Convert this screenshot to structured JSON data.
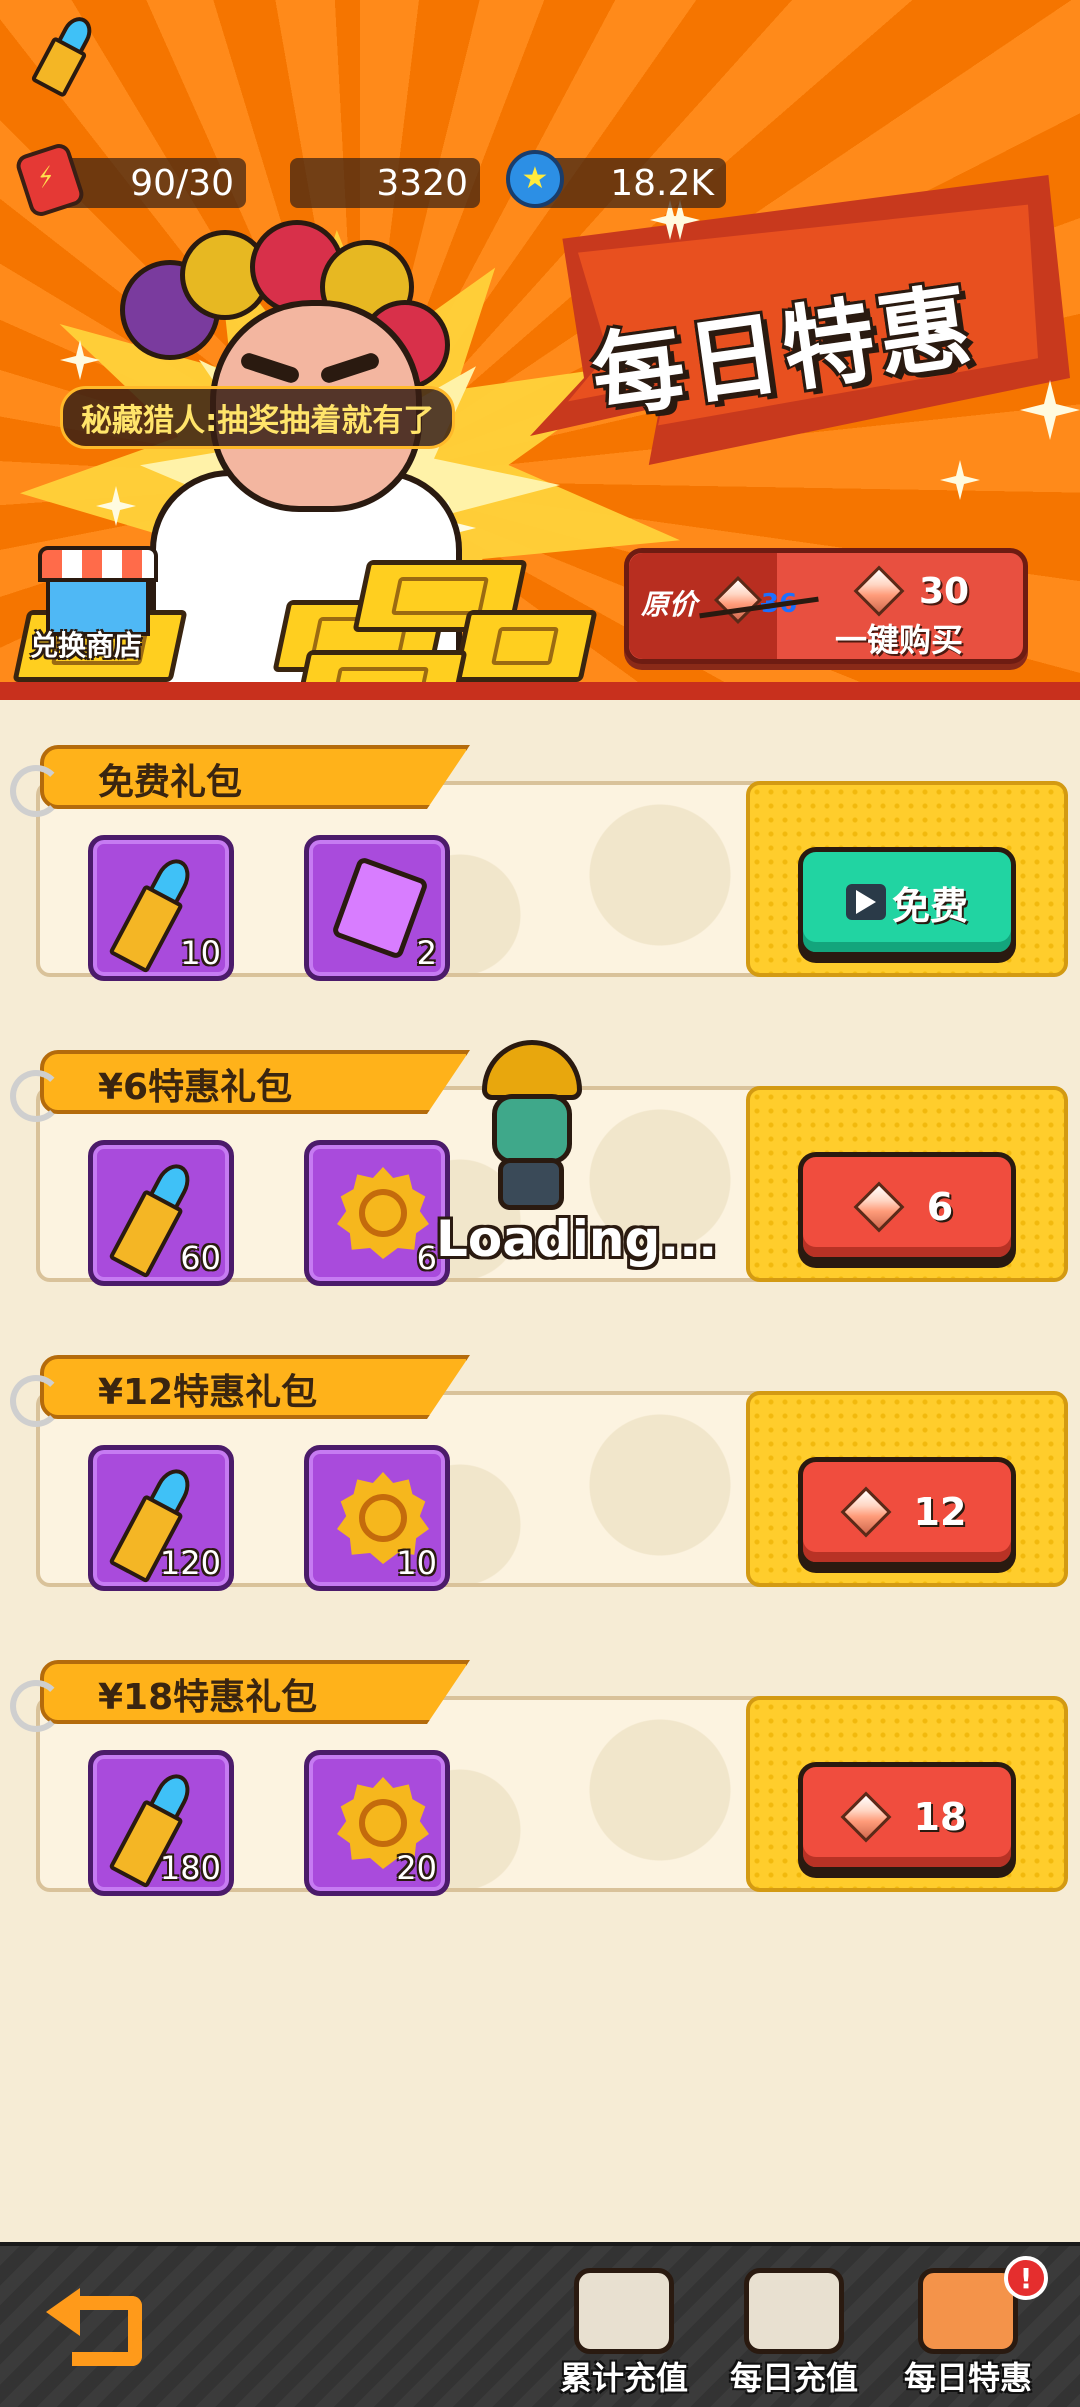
{
  "resources": [
    {
      "icon": "energy-can-icon",
      "value": "90/30"
    },
    {
      "icon": "bullet-icon",
      "value": "3320"
    },
    {
      "icon": "coin-icon",
      "value": "18.2K"
    }
  ],
  "hero": {
    "title": "每日特惠",
    "hunter_text": "秘藏猎人:抽奖抽着就有了",
    "shop_label": "兑换商店",
    "original_price_label": "原价",
    "original_price": "36",
    "buy_all_price": "30",
    "buy_all_label": "一键购买"
  },
  "packs": [
    {
      "name": "免费礼包",
      "items": [
        {
          "icon": "bullet-icon",
          "count": "10"
        },
        {
          "icon": "purple-cube-icon",
          "count": "2"
        }
      ],
      "button": {
        "type": "free",
        "label": "免费"
      }
    },
    {
      "name": "¥6特惠礼包",
      "items": [
        {
          "icon": "bullet-icon",
          "count": "60"
        },
        {
          "icon": "gold-sun-icon",
          "count": "6"
        }
      ],
      "button": {
        "type": "gem",
        "label": "6"
      }
    },
    {
      "name": "¥12特惠礼包",
      "items": [
        {
          "icon": "bullet-icon",
          "count": "120"
        },
        {
          "icon": "gold-sun-icon",
          "count": "10"
        }
      ],
      "button": {
        "type": "gem",
        "label": "12"
      }
    },
    {
      "name": "¥18特惠礼包",
      "items": [
        {
          "icon": "bullet-icon",
          "count": "180"
        },
        {
          "icon": "gold-sun-icon",
          "count": "20"
        }
      ],
      "button": {
        "type": "gem",
        "label": "18"
      }
    }
  ],
  "loading": "Loading...",
  "nav": {
    "tabs": [
      {
        "label": "累计充值",
        "icon": "money-bag-icon"
      },
      {
        "label": "每日充值",
        "icon": "gift-box-icon"
      },
      {
        "label": "每日特惠",
        "icon": "penguin-gift-icon",
        "badge": "!"
      }
    ]
  }
}
